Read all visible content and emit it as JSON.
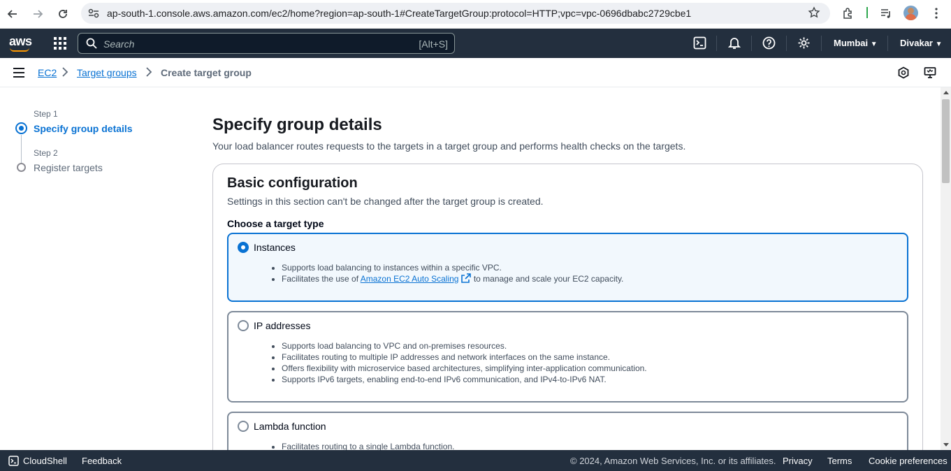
{
  "browser": {
    "url": "ap-south-1.console.aws.amazon.com/ec2/home?region=ap-south-1#CreateTargetGroup:protocol=HTTP;vpc=vpc-0696dbabc2729cbe1"
  },
  "top_nav": {
    "logo": "aws",
    "search_placeholder": "Search",
    "search_shortcut": "[Alt+S]",
    "region": "Mumbai",
    "user": "Divakar"
  },
  "breadcrumb": {
    "items": [
      "EC2",
      "Target groups",
      "Create target group"
    ]
  },
  "steps": [
    {
      "label": "Step 1",
      "title": "Specify group details"
    },
    {
      "label": "Step 2",
      "title": "Register targets"
    }
  ],
  "main": {
    "title": "Specify group details",
    "description": "Your load balancer routes requests to the targets in a target group and performs health checks on the targets."
  },
  "basic_config": {
    "title": "Basic configuration",
    "description": "Settings in this section can't be changed after the target group is created.",
    "target_type_label": "Choose a target type",
    "options": [
      {
        "title": "Instances",
        "bullets": [
          "Supports load balancing to instances within a specific VPC."
        ],
        "bullet2_pre": "Facilitates the use of ",
        "bullet2_link": "Amazon EC2 Auto Scaling",
        "bullet2_post": " to manage and scale your EC2 capacity."
      },
      {
        "title": "IP addresses",
        "bullets": [
          "Supports load balancing to VPC and on-premises resources.",
          "Facilitates routing to multiple IP addresses and network interfaces on the same instance.",
          "Offers flexibility with microservice based architectures, simplifying inter-application communication.",
          "Supports IPv6 targets, enabling end-to-end IPv6 communication, and IPv4-to-IPv6 NAT."
        ]
      },
      {
        "title": "Lambda function",
        "bullets": [
          "Facilitates routing to a single Lambda function."
        ]
      }
    ]
  },
  "footer": {
    "cloudshell": "CloudShell",
    "feedback": "Feedback",
    "copyright": "© 2024, Amazon Web Services, Inc. or its affiliates.",
    "privacy": "Privacy",
    "terms": "Terms",
    "cookies": "Cookie preferences"
  },
  "colors": {
    "nav_bg": "#232f3e",
    "accent": "#0972d3",
    "aws_orange": "#ff9900"
  }
}
